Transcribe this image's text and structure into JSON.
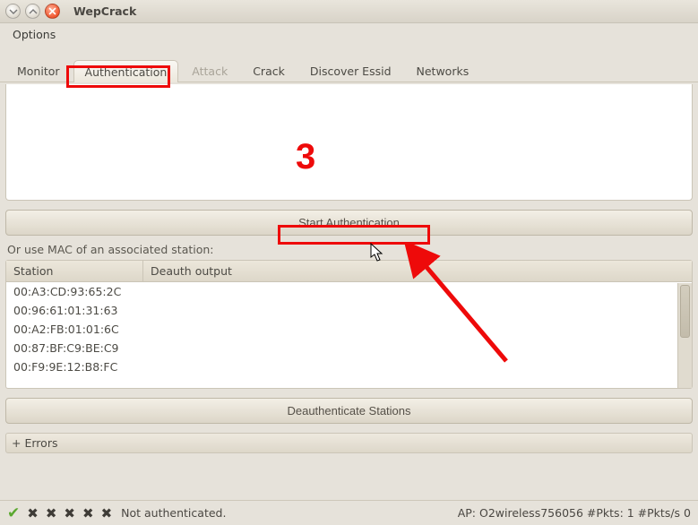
{
  "window": {
    "title": "WepCrack"
  },
  "menu": {
    "options": "Options"
  },
  "tabs": {
    "monitor": "Monitor",
    "authentication": "Authentication",
    "attack": "Attack",
    "crack": "Crack",
    "discover": "Discover Essid",
    "networks": "Networks"
  },
  "auth": {
    "output": "",
    "start_button": "Start Authentication",
    "hint": "Or use MAC of an associated station:",
    "table": {
      "col_station": "Station",
      "col_deauth": "Deauth output",
      "rows": [
        {
          "station": "00:A3:CD:93:65:2C",
          "deauth": ""
        },
        {
          "station": "00:96:61:01:31:63",
          "deauth": ""
        },
        {
          "station": "00:A2:FB:01:01:6C",
          "deauth": ""
        },
        {
          "station": "00:87:BF:C9:BE:C9",
          "deauth": ""
        },
        {
          "station": "00:F9:9E:12:B8:FC",
          "deauth": ""
        }
      ]
    },
    "deauth_button": "Deauthenticate Stations"
  },
  "errors": {
    "expander": "+",
    "label": "Errors"
  },
  "status": {
    "auth_state": "Not authenticated.",
    "ap_info": "AP: O2wireless756056 #Pkts: 1 #Pkts/s 0"
  },
  "annotation": {
    "step": "3"
  }
}
